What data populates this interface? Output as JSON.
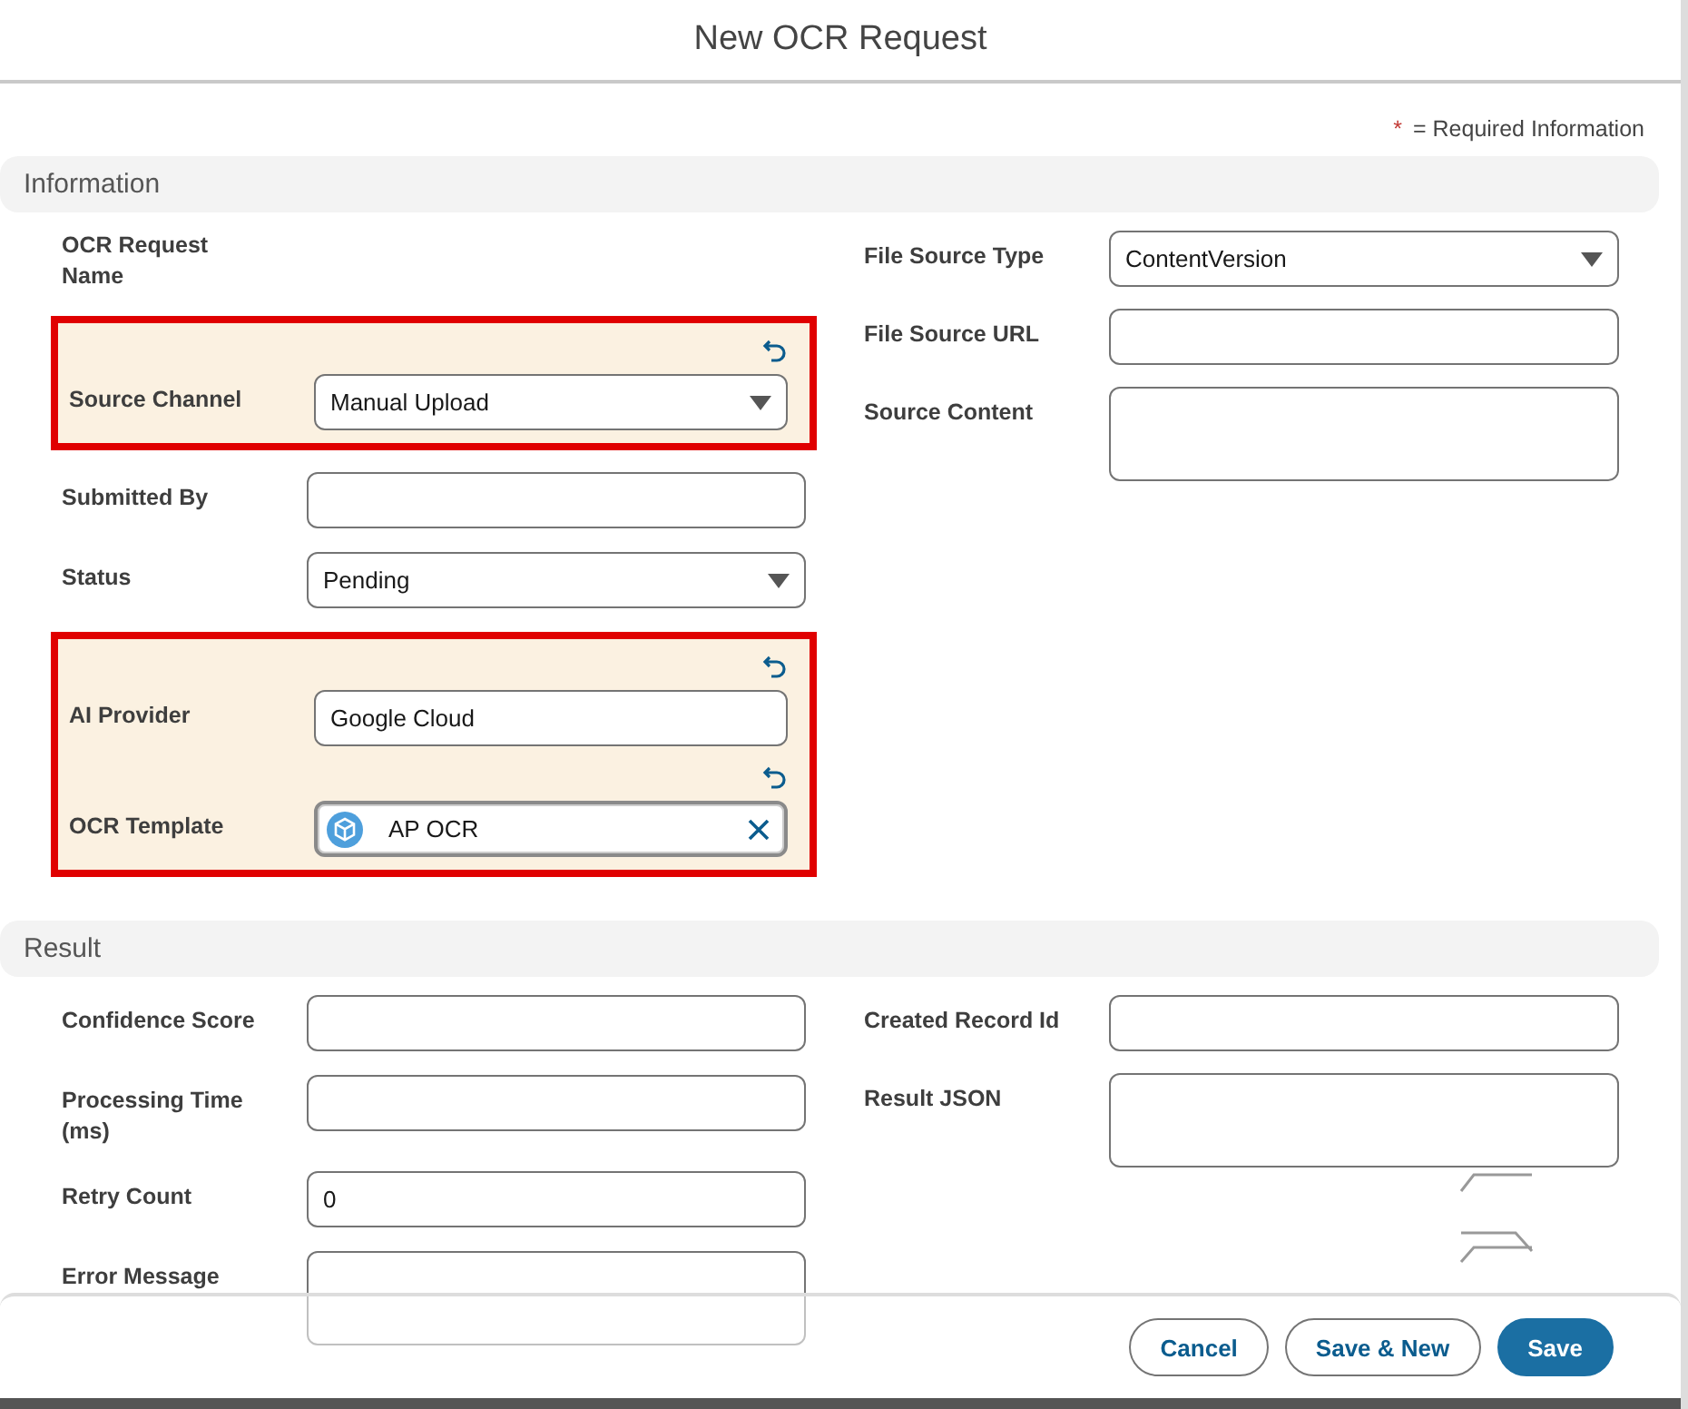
{
  "modal": {
    "title": "New OCR Request"
  },
  "required_note": {
    "mark": "*",
    "text": "= Required Information"
  },
  "sections": [
    {
      "title": "Information",
      "left": [
        {
          "kind": "label_only",
          "label": "OCR Request Name"
        },
        {
          "kind": "group",
          "fields": [
            {
              "kind": "select",
              "label": "Source Channel",
              "value": "Manual Upload",
              "modified": true
            }
          ]
        },
        {
          "kind": "text",
          "label": "Submitted By"
        },
        {
          "kind": "select",
          "label": "Status",
          "value": "Pending"
        },
        {
          "kind": "group",
          "fields": [
            {
              "kind": "text",
              "label": "AI Provider",
              "value": "Google Cloud",
              "modified": true
            },
            {
              "kind": "lookup",
              "label": "OCR Template",
              "value": "AP OCR",
              "modified": true
            }
          ]
        }
      ],
      "right": [
        {
          "kind": "select",
          "label": "File Source Type",
          "value": "ContentVersion"
        },
        {
          "kind": "text",
          "label": "File Source URL"
        },
        {
          "kind": "textarea",
          "label": "Source Content"
        }
      ]
    },
    {
      "title": "Result",
      "left": [
        {
          "kind": "text",
          "label": "Confidence Score"
        },
        {
          "kind": "text",
          "label": "Processing Time (ms)"
        },
        {
          "kind": "text",
          "label": "Retry Count",
          "value": "0"
        },
        {
          "kind": "textarea",
          "label": "Error Message"
        }
      ],
      "right": [
        {
          "kind": "text",
          "label": "Created Record Id"
        },
        {
          "kind": "textarea",
          "label": "Result JSON"
        }
      ]
    }
  ],
  "footer": {
    "buttons": [
      {
        "label": "Cancel",
        "kind": "neutral"
      },
      {
        "label": "Save & New",
        "kind": "neutral"
      },
      {
        "label": "Save",
        "kind": "brand"
      }
    ]
  }
}
